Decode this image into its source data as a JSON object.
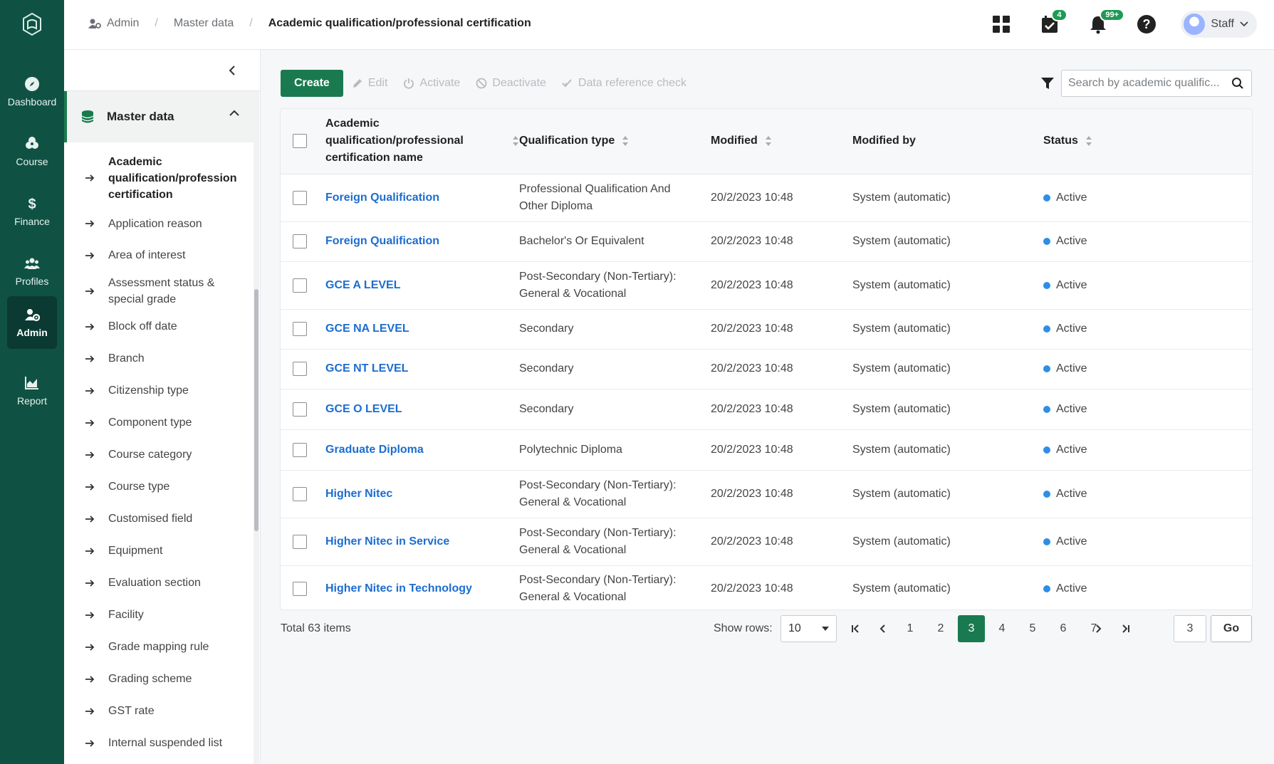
{
  "rail": {
    "items": [
      {
        "label": "Dashboard",
        "icon": "compass-icon"
      },
      {
        "label": "Course",
        "icon": "course-icon"
      },
      {
        "label": "Finance",
        "icon": "dollar-icon"
      },
      {
        "label": "Profiles",
        "icon": "people-icon"
      },
      {
        "label": "Admin",
        "icon": "admin-gear-icon",
        "active": true
      },
      {
        "label": "Report",
        "icon": "chart-icon"
      }
    ]
  },
  "breadcrumb": {
    "admin": "Admin",
    "master_data": "Master data",
    "current": "Academic qualification/professional certification"
  },
  "header": {
    "calendar_badge": "4",
    "notifications_badge": "99+",
    "user_label": "Staff"
  },
  "sidebar": {
    "section_label": "Master data",
    "items": [
      {
        "label": "Academic qualification/profession certification"
      },
      {
        "label": "Application reason"
      },
      {
        "label": "Area of interest"
      },
      {
        "label": "Assessment status & special grade"
      },
      {
        "label": "Block off date"
      },
      {
        "label": "Branch"
      },
      {
        "label": "Citizenship type"
      },
      {
        "label": "Component type"
      },
      {
        "label": "Course category"
      },
      {
        "label": "Course type"
      },
      {
        "label": "Customised field"
      },
      {
        "label": "Equipment"
      },
      {
        "label": "Evaluation section"
      },
      {
        "label": "Facility"
      },
      {
        "label": "Grade mapping rule"
      },
      {
        "label": "Grading scheme"
      },
      {
        "label": "GST rate"
      },
      {
        "label": "Internal suspended list"
      }
    ]
  },
  "toolbar": {
    "create": "Create",
    "edit": "Edit",
    "activate": "Activate",
    "deactivate": "Deactivate",
    "data_reference_check": "Data reference check",
    "search_placeholder": "Search by academic qualific..."
  },
  "table": {
    "headers": {
      "name": "Academic qualification/professional certification name",
      "type": "Qualification type",
      "modified": "Modified",
      "modified_by": "Modified by",
      "status": "Status"
    },
    "rows": [
      {
        "name": "Foreign Qualification",
        "type": "Professional Qualification And Other Diploma",
        "modified": "20/2/2023 10:48",
        "modified_by": "System (automatic)",
        "status": "Active"
      },
      {
        "name": "Foreign Qualification",
        "type": "Bachelor's Or Equivalent",
        "modified": "20/2/2023 10:48",
        "modified_by": "System (automatic)",
        "status": "Active"
      },
      {
        "name": "GCE A LEVEL",
        "type": "Post-Secondary (Non-Tertiary): General & Vocational",
        "modified": "20/2/2023 10:48",
        "modified_by": "System (automatic)",
        "status": "Active"
      },
      {
        "name": "GCE NA LEVEL",
        "type": "Secondary",
        "modified": "20/2/2023 10:48",
        "modified_by": "System (automatic)",
        "status": "Active"
      },
      {
        "name": "GCE NT LEVEL",
        "type": "Secondary",
        "modified": "20/2/2023 10:48",
        "modified_by": "System (automatic)",
        "status": "Active"
      },
      {
        "name": "GCE O LEVEL",
        "type": "Secondary",
        "modified": "20/2/2023 10:48",
        "modified_by": "System (automatic)",
        "status": "Active"
      },
      {
        "name": "Graduate Diploma",
        "type": "Polytechnic Diploma",
        "modified": "20/2/2023 10:48",
        "modified_by": "System (automatic)",
        "status": "Active"
      },
      {
        "name": "Higher Nitec",
        "type": "Post-Secondary (Non-Tertiary): General & Vocational",
        "modified": "20/2/2023 10:48",
        "modified_by": "System (automatic)",
        "status": "Active"
      },
      {
        "name": "Higher Nitec in Service",
        "type": "Post-Secondary (Non-Tertiary): General & Vocational",
        "modified": "20/2/2023 10:48",
        "modified_by": "System (automatic)",
        "status": "Active"
      },
      {
        "name": "Higher Nitec in Technology",
        "type": "Post-Secondary (Non-Tertiary): General & Vocational",
        "modified": "20/2/2023 10:48",
        "modified_by": "System (automatic)",
        "status": "Active"
      }
    ]
  },
  "footer": {
    "total": "Total 63 items",
    "show_rows_label": "Show rows:",
    "rows_value": "10",
    "pages": [
      "1",
      "2",
      "3",
      "4",
      "5",
      "6",
      "7"
    ],
    "current_page": "3",
    "goto_value": "3",
    "go_label": "Go"
  },
  "colors": {
    "rail": "#0f5244",
    "primary": "#1a7a4f",
    "link": "#1c6dd0",
    "status_dot": "#2e8ee6"
  }
}
